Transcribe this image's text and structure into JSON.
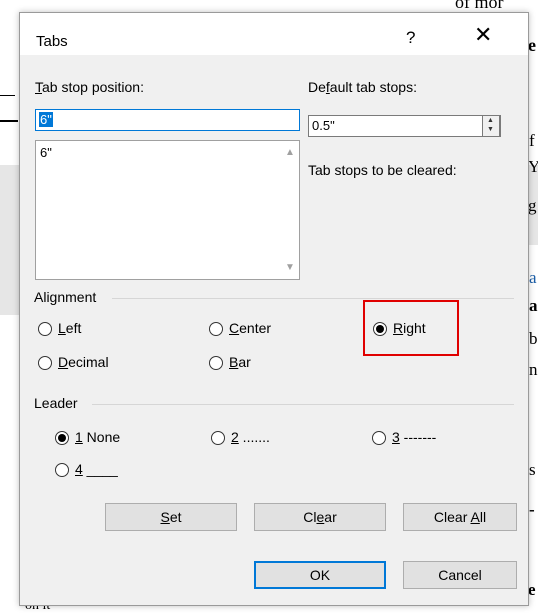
{
  "background_doc": {
    "top_text": "of mor",
    "right_fragments": [
      "e",
      "f",
      "Y",
      "g",
      "a",
      "a",
      "b",
      "n",
      "s",
      "-",
      "e"
    ],
    "bottom_text": "on it"
  },
  "dialog": {
    "title": "Tabs",
    "help_label": "?",
    "close_label": "✕",
    "tab_stop_position": {
      "label_prefix": "T",
      "label_rest": "ab stop position:",
      "value": "6\"",
      "list_items": [
        "6\""
      ]
    },
    "default_tab_stops": {
      "label_prefix": "De",
      "label_underline": "f",
      "label_rest": "ault tab stops:",
      "value": "0.5\""
    },
    "tab_stops_cleared_label": "Tab stops to be cleared:",
    "alignment": {
      "group_label": "Alignment",
      "options": [
        {
          "key": "L",
          "rest": "eft",
          "checked": false
        },
        {
          "key": "C",
          "rest": "enter",
          "checked": false
        },
        {
          "key": "R",
          "rest": "ight",
          "checked": true
        },
        {
          "key": "D",
          "rest": "ecimal",
          "checked": false
        },
        {
          "key": "B",
          "rest": "ar",
          "checked": false
        }
      ]
    },
    "leader": {
      "group_label": "Leader",
      "options": [
        {
          "key": "1",
          "rest": " None",
          "checked": true
        },
        {
          "key": "2",
          "rest": " .......",
          "checked": false
        },
        {
          "key": "3",
          "rest": " -------",
          "checked": false
        },
        {
          "key": "4",
          "rest": " ____",
          "checked": false
        }
      ]
    },
    "buttons": {
      "set": {
        "key": "S",
        "rest": "et"
      },
      "clear": {
        "prefix": "Cl",
        "key": "e",
        "rest": "ar"
      },
      "clear_all": {
        "prefix": "Clear ",
        "key": "A",
        "rest": "ll"
      },
      "ok": "OK",
      "cancel": "Cancel"
    }
  }
}
